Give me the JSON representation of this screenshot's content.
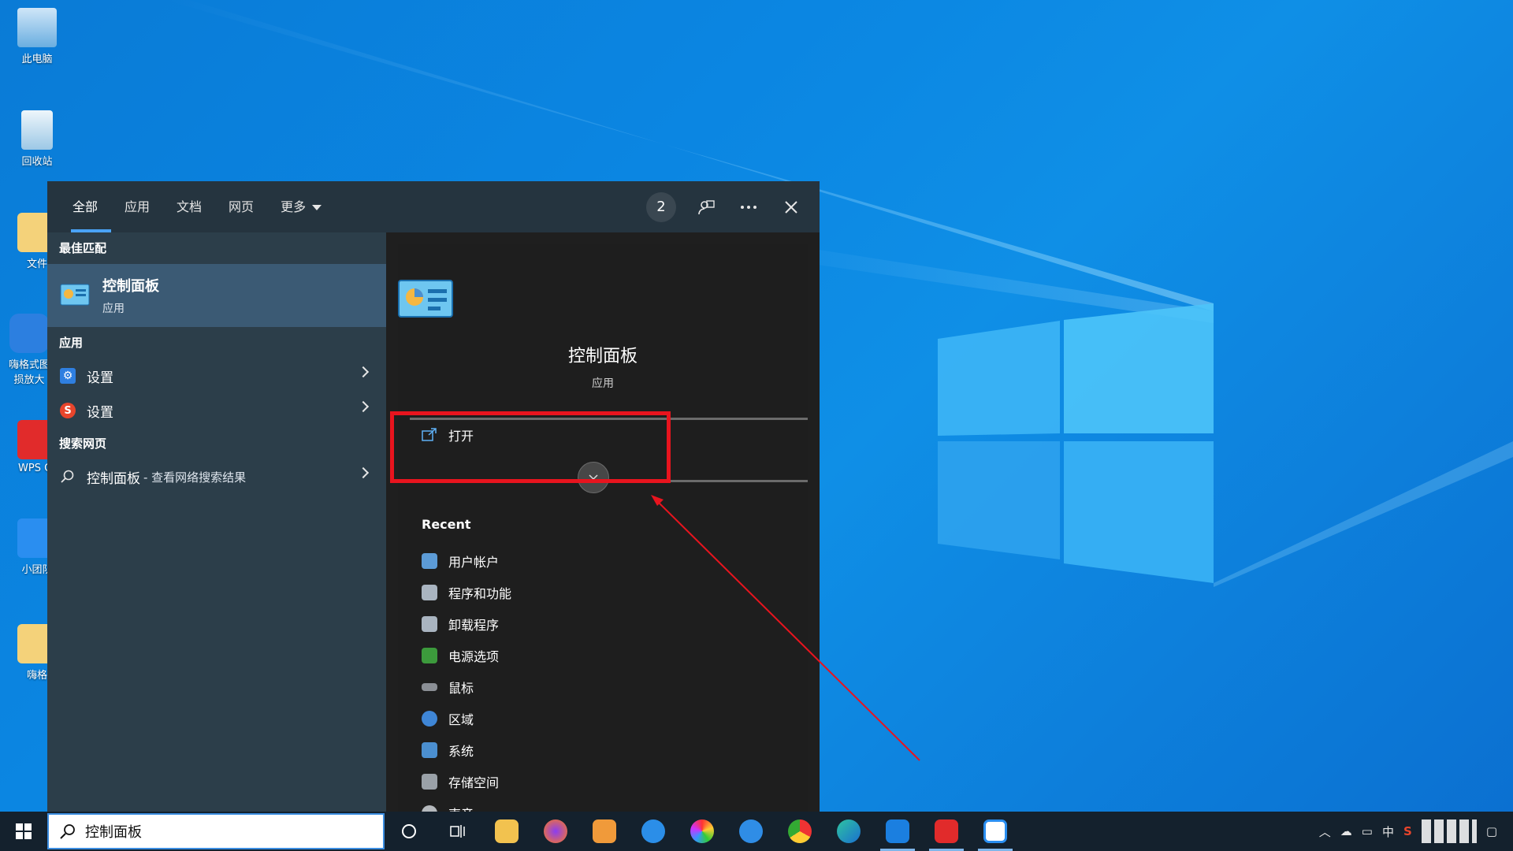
{
  "desktop": {
    "icons": [
      {
        "label": "此电脑"
      },
      {
        "label": "回收站"
      },
      {
        "label": "文件"
      },
      {
        "label": "嗨格式图\n损放大"
      },
      {
        "label": "WPS Of"
      },
      {
        "label": "小团队"
      },
      {
        "label": "嗨格"
      }
    ]
  },
  "search_panel": {
    "tabs": [
      {
        "label": "全部"
      },
      {
        "label": "应用"
      },
      {
        "label": "文档"
      },
      {
        "label": "网页"
      },
      {
        "label": "更多"
      }
    ],
    "badge_count": "2",
    "best_match_title": "最佳匹配",
    "best_match": {
      "name": "控制面板",
      "type": "应用"
    },
    "apps_title": "应用",
    "apps": [
      {
        "label": "设置"
      },
      {
        "label": "设置"
      }
    ],
    "web_title": "搜索网页",
    "web_item": {
      "label": "控制面板",
      "sub": "- 查看网络搜索结果"
    },
    "detail": {
      "title": "控制面板",
      "subtitle": "应用",
      "open_label": "打开",
      "recent_title": "Recent",
      "recent_items": [
        {
          "label": "用户帐户"
        },
        {
          "label": "程序和功能"
        },
        {
          "label": "卸载程序"
        },
        {
          "label": "电源选项"
        },
        {
          "label": "鼠标"
        },
        {
          "label": "区域"
        },
        {
          "label": "系统"
        },
        {
          "label": "存储空间"
        },
        {
          "label": "声音"
        }
      ]
    }
  },
  "taskbar": {
    "search_value": "控制面板",
    "tray_lang": "中"
  },
  "colors": {
    "accent": "#4aa3f7",
    "annotation_red": "#e8141e"
  }
}
